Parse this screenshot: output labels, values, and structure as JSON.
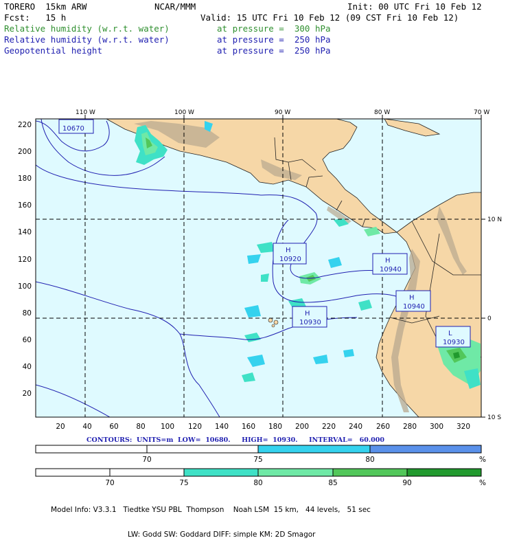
{
  "header": {
    "model": "TORERO  15km ARW",
    "org": "NCAR/MMM",
    "init": "Init: 00 UTC Fri 10 Feb 12",
    "fcst": "Fcst:   15 h",
    "valid": "Valid: 15 UTC Fri 10 Feb 12 (09 CST Fri 10 Feb 12)",
    "fields": [
      {
        "name": "Relative humidity (w.r.t. water)",
        "level": "at pressure =  300 hPa",
        "color": "#2f8f2f"
      },
      {
        "name": "Relative humidity (w.r.t. water)",
        "level": "at pressure =  250 hPa",
        "color": "#1f1fb0"
      },
      {
        "name": "Geopotential height",
        "level": "at pressure =  250 hPa",
        "color": "#1f1fb0"
      }
    ]
  },
  "map": {
    "ocean_color": "#dffaff",
    "land_color": "#f6d7a7",
    "top_lon_labels": [
      "110 W",
      "100 W",
      "90 W",
      "80 W",
      "70 W"
    ],
    "right_lat_labels": [
      "10 N",
      "0",
      "10 S"
    ],
    "y_ticks": [
      "220",
      "200",
      "180",
      "160",
      "140",
      "120",
      "100",
      "80",
      "60",
      "40",
      "20"
    ],
    "x_ticks": [
      "20",
      "40",
      "60",
      "80",
      "100",
      "120",
      "140",
      "160",
      "180",
      "200",
      "220",
      "240",
      "260",
      "280",
      "300",
      "320"
    ],
    "height_labels": [
      {
        "type": "",
        "value": "10670"
      },
      {
        "type": "H",
        "value": "10920"
      },
      {
        "type": "H",
        "value": "10940"
      },
      {
        "type": "H",
        "value": "10930"
      },
      {
        "type": "H",
        "value": "10940"
      },
      {
        "type": "L",
        "value": "10930"
      }
    ]
  },
  "contours_text": "CONTOURS:  UNITS=m  LOW=  10680.     HIGH=  10930.     INTERVAL=   60.000",
  "colorbar_250": {
    "labels": [
      "70",
      "75",
      "80"
    ],
    "unit": "%",
    "colors": [
      "#ffffff",
      "#ffffff",
      "#35d2ee",
      "#5a91ea"
    ]
  },
  "colorbar_300": {
    "labels": [
      "70",
      "75",
      "80",
      "85",
      "90"
    ],
    "unit": "%",
    "colors": [
      "#ffffff",
      "#ffffff",
      "#3fe1c6",
      "#6fe9a6",
      "#52c75a",
      "#219a2e"
    ]
  },
  "model_info": [
    "Model Info: V3.3.1   Tiedtke YSU PBL  Thompson    Noah LSM  15 km,   44 levels,   51 sec",
    "LW: Godd SW: Goddard DIFF: simple KM: 2D Smagor"
  ]
}
